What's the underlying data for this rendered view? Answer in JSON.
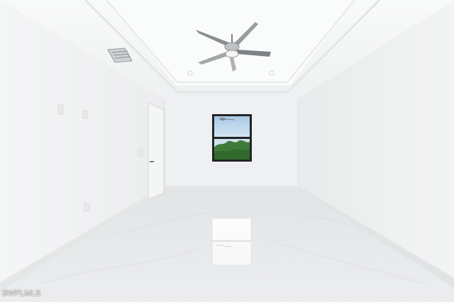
{
  "photo": {
    "subject": "empty-room",
    "watermark": "SWFLMLS",
    "colors": {
      "ceiling": "#f7f8f8",
      "walls": "#f0f1f2",
      "floor": "#e4e6e8",
      "window_glass": "#bfd8ee",
      "foliage": "#3f7a3a",
      "fan_metal": "#8a8c8f"
    }
  }
}
